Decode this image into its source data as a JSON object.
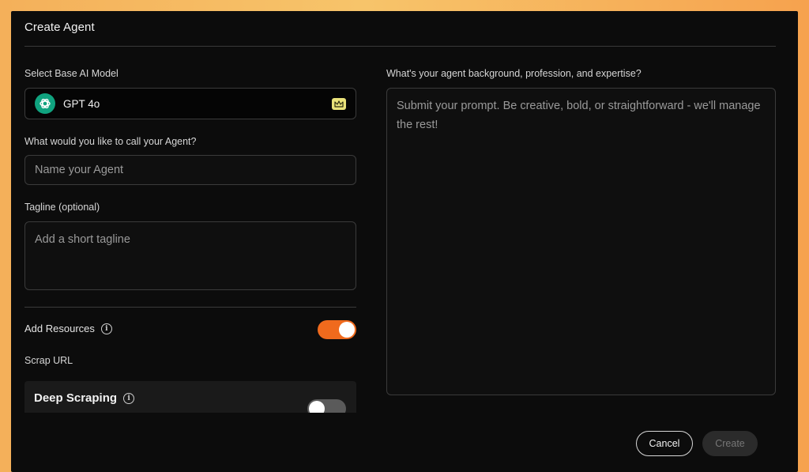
{
  "dialog": {
    "title": "Create Agent"
  },
  "model": {
    "label": "Select Base AI Model",
    "selected": "GPT 4o",
    "logo_icon": "openai-logo-icon",
    "badge_icon": "crown-icon",
    "logo_color": "#10a37f",
    "badge_color": "#e9e27a"
  },
  "name_field": {
    "label": "What would you like to call your Agent?",
    "placeholder": "Name your Agent",
    "value": ""
  },
  "tagline_field": {
    "label": "Tagline (optional)",
    "placeholder": "Add a short tagline",
    "value": ""
  },
  "resources": {
    "label": "Add Resources",
    "enabled": true,
    "scrap_url_label": "Scrap URL",
    "toggle_on_color": "#f06a1d"
  },
  "deep_scraping": {
    "label": "Deep Scraping",
    "enabled": false
  },
  "prompt_field": {
    "label": "What's your agent background, profession, and expertise?",
    "placeholder": "Submit your prompt. Be creative, bold, or straightforward - we'll manage the rest!",
    "value": ""
  },
  "actions": {
    "cancel_label": "Cancel",
    "create_label": "Create"
  }
}
